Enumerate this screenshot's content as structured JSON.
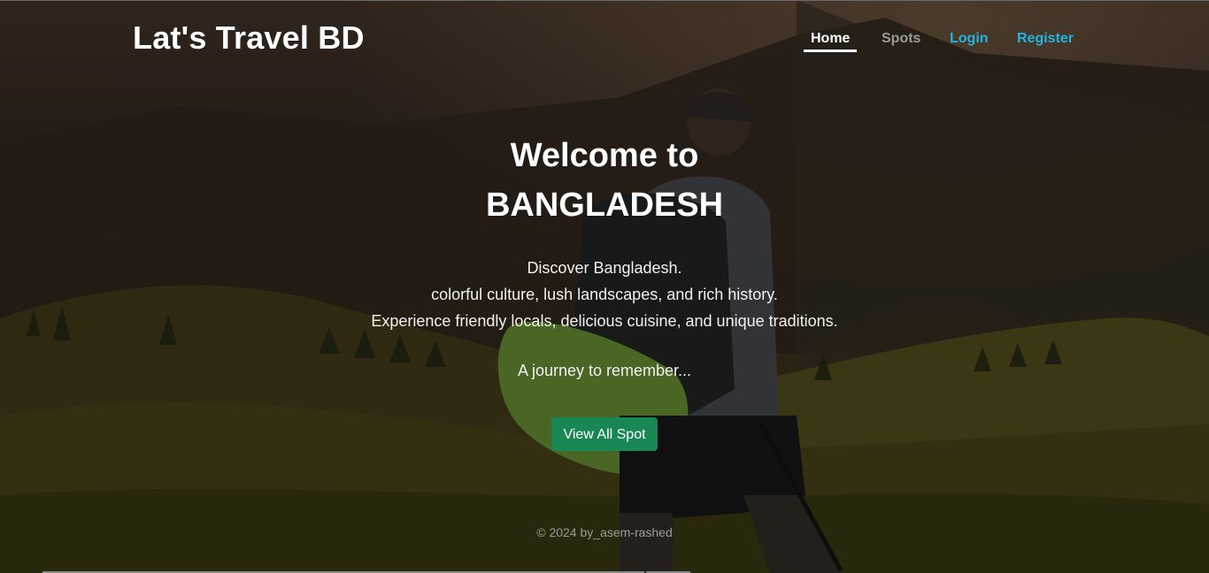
{
  "brand": "Lat's Travel BD",
  "nav": {
    "home": "Home",
    "spots": "Spots",
    "login": "Login",
    "register": "Register"
  },
  "hero": {
    "title_line1": "Welcome to",
    "title_line2": "BANGLADESH",
    "desc_line1": "Discover Bangladesh.",
    "desc_line2": "colorful culture, lush landscapes, and rich history.",
    "desc_line3": "Experience friendly locals, delicious cuisine, and unique traditions.",
    "tagline": "A journey to remember...",
    "cta_label": "View All Spot"
  },
  "footer": "© 2024 by_asem-rashed",
  "colors": {
    "accent_green": "#198754",
    "link_blue": "#22b4e0",
    "muted_gray": "#9a9a9a"
  }
}
